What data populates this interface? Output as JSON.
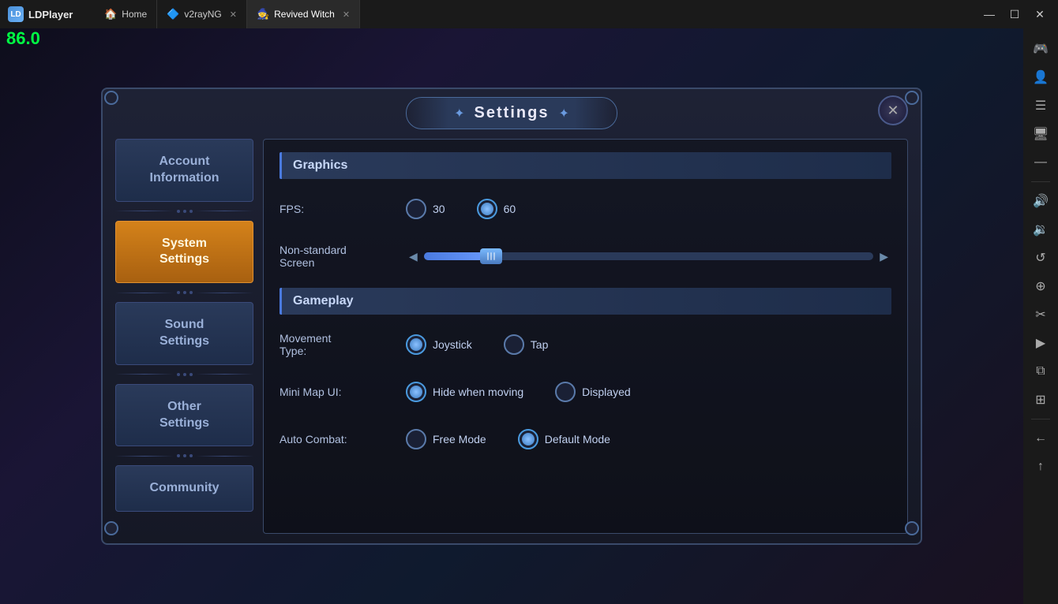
{
  "app": {
    "name": "LDPlayer",
    "fps": "86.0"
  },
  "tabs": [
    {
      "id": "home",
      "icon": "🏠",
      "label": "Home",
      "active": false,
      "closeable": false
    },
    {
      "id": "v2rayng",
      "icon": "🔷",
      "label": "v2rayNG",
      "active": false,
      "closeable": true
    },
    {
      "id": "revivedwitch",
      "icon": "🧙",
      "label": "Revived Witch",
      "active": true,
      "closeable": true
    }
  ],
  "win_controls": {
    "minimize": "—",
    "maximize": "☐",
    "close": "✕"
  },
  "right_toolbar": {
    "buttons": [
      {
        "id": "gamepad",
        "icon": "🎮"
      },
      {
        "id": "account",
        "icon": "👤"
      },
      {
        "id": "settings",
        "icon": "☰"
      },
      {
        "id": "display",
        "icon": "🖥"
      },
      {
        "id": "minimize-tb",
        "icon": "—"
      },
      {
        "id": "volume-up",
        "icon": "🔊"
      },
      {
        "id": "volume-dn",
        "icon": "🔉"
      },
      {
        "id": "rotate",
        "icon": "↺"
      },
      {
        "id": "zoom-in",
        "icon": "⊕"
      },
      {
        "id": "cut",
        "icon": "✂"
      },
      {
        "id": "play",
        "icon": "▶"
      },
      {
        "id": "copy",
        "icon": "⧉"
      },
      {
        "id": "grid",
        "icon": "⊞"
      },
      {
        "id": "arrow-left",
        "icon": "←"
      },
      {
        "id": "arrow-up",
        "icon": "↑"
      }
    ]
  },
  "dialog": {
    "title": "Settings",
    "close_icon": "✕",
    "sidebar": {
      "items": [
        {
          "id": "account",
          "label": "Account\nInformation",
          "active": false
        },
        {
          "id": "system",
          "label": "System\nSettings",
          "active": true
        },
        {
          "id": "sound",
          "label": "Sound\nSettings",
          "active": false
        },
        {
          "id": "other",
          "label": "Other\nSettings",
          "active": false
        },
        {
          "id": "community",
          "label": "Community",
          "active": false
        }
      ]
    },
    "content": {
      "sections": [
        {
          "id": "graphics",
          "title": "Graphics",
          "settings": [
            {
              "id": "fps",
              "label": "FPS:",
              "type": "radio",
              "options": [
                {
                  "value": "30",
                  "label": "30",
                  "selected": false
                },
                {
                  "value": "60",
                  "label": "60",
                  "selected": true
                }
              ]
            },
            {
              "id": "nonstandard",
              "label": "Non-standard\nScreen",
              "type": "slider",
              "value": 15
            }
          ]
        },
        {
          "id": "gameplay",
          "title": "Gameplay",
          "settings": [
            {
              "id": "movement",
              "label": "Movement\nType:",
              "type": "radio",
              "options": [
                {
                  "value": "joystick",
                  "label": "Joystick",
                  "selected": true
                },
                {
                  "value": "tap",
                  "label": "Tap",
                  "selected": false
                }
              ]
            },
            {
              "id": "minimap",
              "label": "Mini Map UI:",
              "type": "radio",
              "options": [
                {
                  "value": "hide",
                  "label": "Hide when moving",
                  "selected": true
                },
                {
                  "value": "display",
                  "label": "Displayed",
                  "selected": false
                }
              ]
            },
            {
              "id": "autocombat",
              "label": "Auto Combat:",
              "type": "radio",
              "options": [
                {
                  "value": "free",
                  "label": "Free Mode",
                  "selected": false
                },
                {
                  "value": "default",
                  "label": "Default Mode",
                  "selected": true
                }
              ]
            }
          ]
        }
      ]
    }
  }
}
